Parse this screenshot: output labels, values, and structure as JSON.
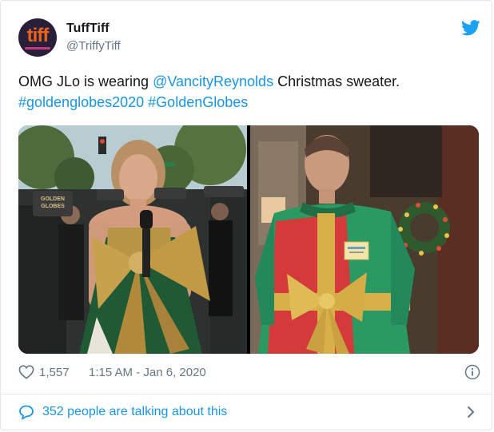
{
  "tweet": {
    "display_name": "TuffTiff",
    "handle": "@TriffyTiff",
    "avatar": {
      "logo_text": "tiff",
      "icon": "tiff-logo"
    },
    "text_prefix": "OMG JLo is wearing ",
    "mention": "@VancityReynolds",
    "text_suffix": " Christmas sweater.",
    "hashtag_1": "#goldenglobes2020",
    "hashtag_2": "#GoldenGlobes",
    "media": {
      "left_photo": {
        "sign_1": "GOLDEN GLOBES",
        "sign_2": "",
        "mic_flag": ""
      },
      "right_photo": {
        "name_tag": ""
      }
    },
    "likes": "1,557",
    "timestamp": "1:15 AM - Jan 6, 2020",
    "talking": "352 people are talking about this"
  },
  "icons": {
    "platform": "twitter-bird-icon",
    "like": "heart-icon",
    "info": "info-icon",
    "reply": "speech-bubble-icon",
    "more": "chevron-right-icon"
  },
  "colors": {
    "link": "#1b95e0",
    "text": "#14171a",
    "muted": "#657786",
    "border": "#e1e8ed"
  }
}
